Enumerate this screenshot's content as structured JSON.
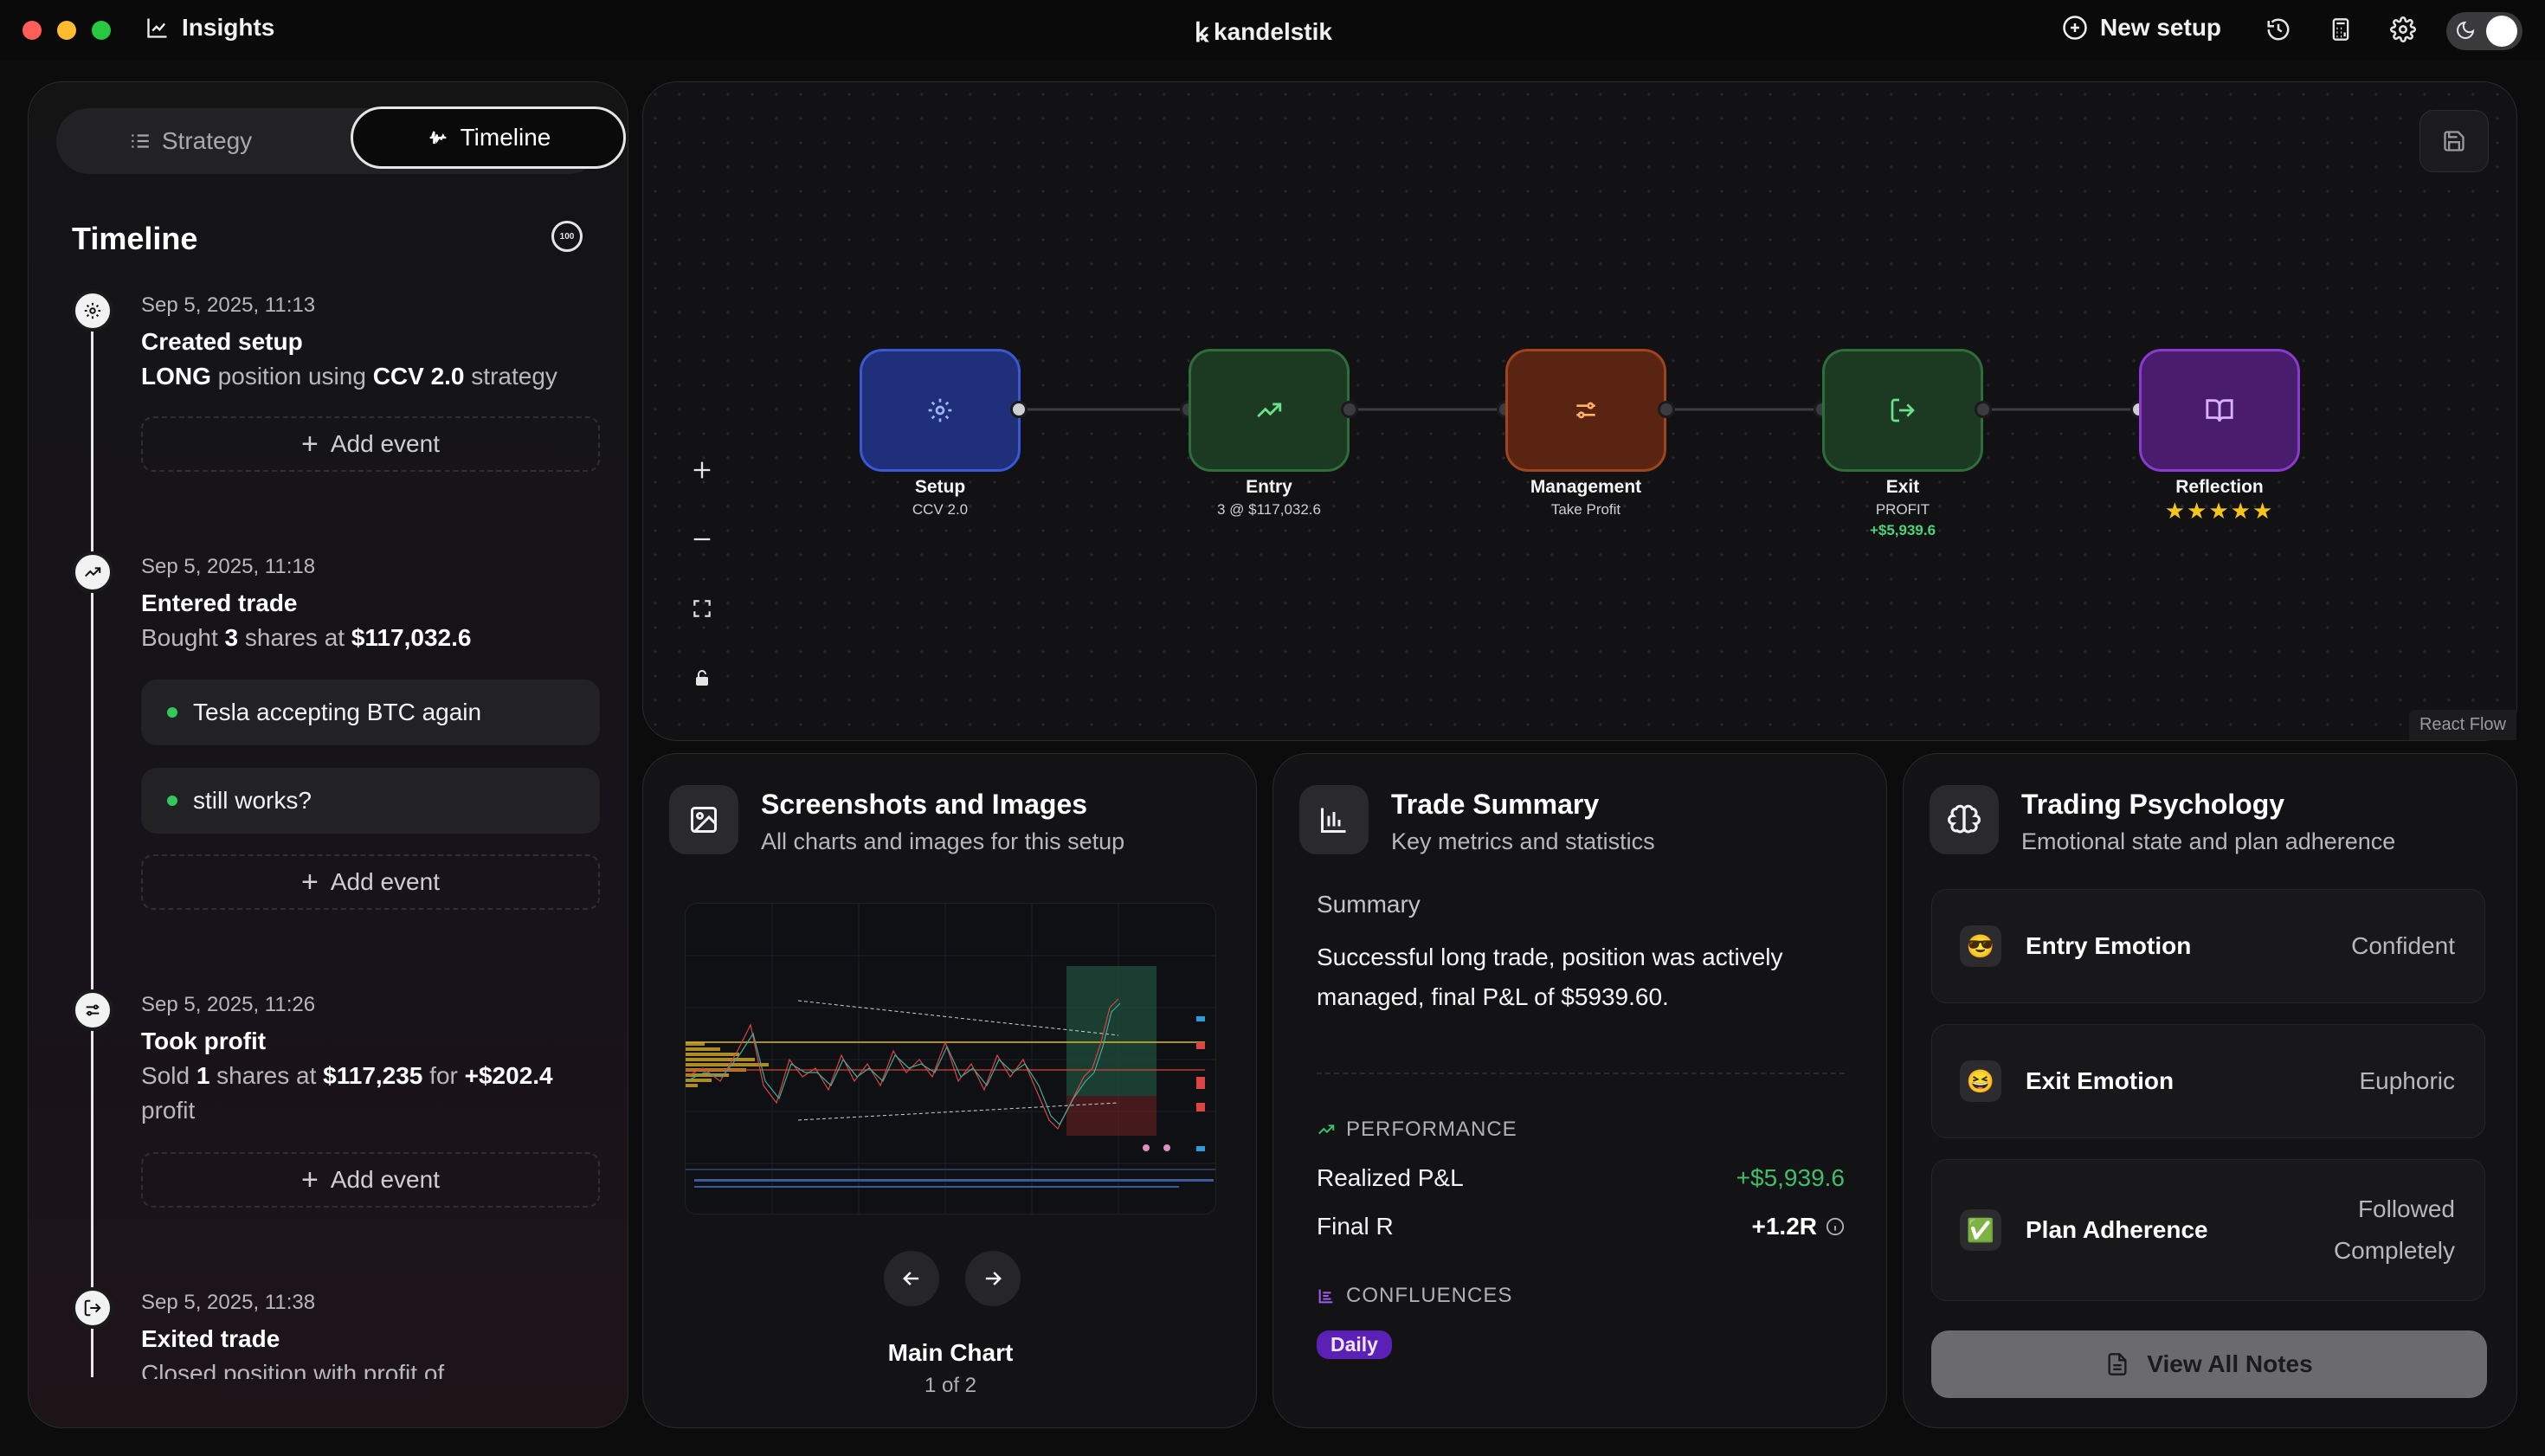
{
  "topbar": {
    "app_section": "Insights",
    "brand": "kandelstik",
    "new_setup_label": "New setup",
    "icons": [
      "history-icon",
      "calculator-icon",
      "gear-icon",
      "theme-toggle"
    ]
  },
  "sidebar": {
    "tabs": [
      {
        "label": "Strategy",
        "icon": "list-icon",
        "active": false
      },
      {
        "label": "Timeline",
        "icon": "activity-icon",
        "active": true
      }
    ],
    "title": "Timeline",
    "title_icon": "percent-badge-icon",
    "add_event_label": "Add event",
    "events": [
      {
        "icon": "gear-icon",
        "date": "Sep 5, 2025, 11:13",
        "title": "Created setup",
        "desc": {
          "pre": "",
          "b1": "LONG",
          "mid": " position using ",
          "b2": "CCV 2.0",
          "post": " strategy"
        }
      },
      {
        "icon": "trending-up-icon",
        "date": "Sep 5, 2025, 11:18",
        "title": "Entered trade",
        "desc": {
          "pre": "Bought ",
          "b1": "3",
          "mid": " shares at ",
          "b2": "$117,032.6",
          "post": ""
        },
        "notes": [
          "Tesla accepting BTC again",
          "still works?"
        ]
      },
      {
        "icon": "sliders-icon",
        "date": "Sep 5, 2025, 11:26",
        "title": "Took profit",
        "desc": {
          "pre": "Sold ",
          "b1": "1",
          "mid": " shares at ",
          "b2": "$117,235",
          "mid2": " for ",
          "b3": "+$202.4",
          "post": " profit"
        }
      },
      {
        "icon": "exit-icon",
        "date": "Sep 5, 2025, 11:38",
        "title": "Exited trade",
        "desc_text": "Closed position with profit of"
      }
    ]
  },
  "flow": {
    "attribution": "React Flow",
    "nodes": [
      {
        "label": "Setup",
        "sub": "CCV 2.0",
        "icon": "gear-icon",
        "color": "#1f2f7a",
        "border": "#3a57d6"
      },
      {
        "label": "Entry",
        "sub": "3 @ $117,032.6",
        "icon": "trending-up-icon",
        "color": "#1b3a21",
        "border": "#2f6d3a"
      },
      {
        "label": "Management",
        "sub": "Take Profit",
        "icon": "sliders-icon",
        "color": "#5a2413",
        "border": "#a0441e"
      },
      {
        "label": "Exit",
        "sub": "PROFIT",
        "extra": "+$5,939.6",
        "icon": "exit-icon",
        "color": "#1b3a21",
        "border": "#2f6d3a"
      },
      {
        "label": "Reflection",
        "stars": "★★★★★",
        "icon": "book-icon",
        "color": "#4a1c6e",
        "border": "#8a3ad0"
      }
    ]
  },
  "screenshots": {
    "title": "Screenshots and Images",
    "subtitle": "All charts and images for this setup",
    "caption": "Main Chart",
    "counter": "1 of 2"
  },
  "summary": {
    "title": "Trade Summary",
    "subtitle": "Key metrics and statistics",
    "section": "Summary",
    "text": "Successful long trade, position was actively managed, final P&L of $5939.60.",
    "performance_label": "PERFORMANCE",
    "metrics": [
      {
        "label": "Realized P&L",
        "value": "+$5,939.6",
        "color": "#3fbf6a"
      },
      {
        "label": "Final R",
        "value": "+1.2R",
        "color": "#ffffff"
      }
    ],
    "confluences_label": "CONFLUENCES",
    "confluence_tag": "Daily"
  },
  "psychology": {
    "title": "Trading Psychology",
    "subtitle": "Emotional state and plan adherence",
    "items": [
      {
        "emoji": "😎",
        "label": "Entry Emotion",
        "value": "Confident"
      },
      {
        "emoji": "😆",
        "label": "Exit Emotion",
        "value": "Euphoric"
      },
      {
        "emoji": "✅",
        "label": "Plan Adherence",
        "value_line1": "Followed",
        "value_line2": "Completely"
      }
    ],
    "view_notes_label": "View All Notes"
  },
  "colors": {
    "accent_green": "#3fbf6a",
    "tag_purple": "#5b21b6"
  }
}
